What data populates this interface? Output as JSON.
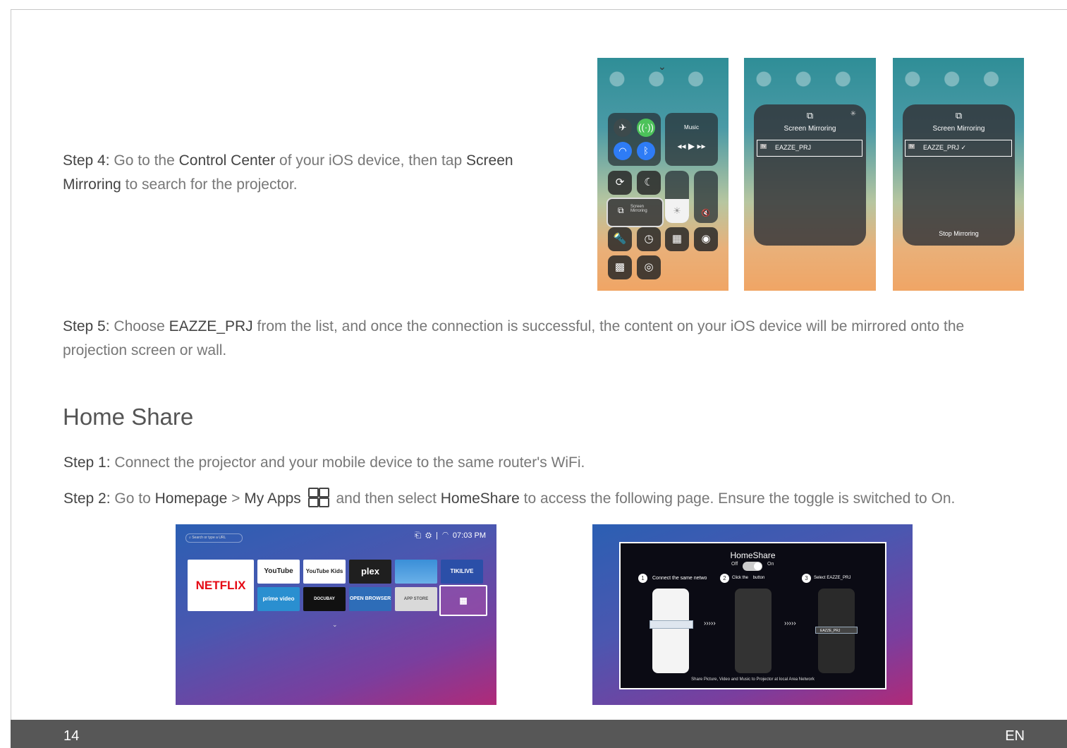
{
  "step4": {
    "label": "Step 4:",
    "t1": " Go to the ",
    "b1": "Control Center",
    "t2": " of your iOS device, then tap ",
    "b2": "Screen",
    "b3": "Mirroring",
    "t3": " to search for the projector."
  },
  "step5": {
    "label": "Step 5:",
    "t1": " Choose ",
    "b1": "EAZZE_PRJ",
    "t2": " from the list, and once the connection is successful, the content on your iOS device will be mirrored onto the",
    "t3": "projection screen or wall."
  },
  "section_title": "Home Share",
  "hs_step1": {
    "label": "Step 1:",
    "text": " Connect the projector and your mobile device to the same router's WiFi."
  },
  "hs_step2": {
    "label": "Step 2:",
    "t1": " Go to ",
    "b1": "Homepage",
    "t2": " > ",
    "b2": "My Apps",
    "t3": " and then select ",
    "b3": "HomeShare",
    "t4": " to access the following page. Ensure the toggle is switched to On."
  },
  "ios": {
    "music": "Music",
    "screen_mirroring_small": "Screen\nMirroring",
    "screen_mirroring": "Screen Mirroring",
    "device": "EAZZE_PRJ",
    "device_connected": "EAZZE_PRJ ✓",
    "stop": "Stop Mirroring"
  },
  "tv1": {
    "search_placeholder": "Search or type a URL",
    "time": "07:03 PM",
    "apps": [
      "NETFLIX",
      "YouTube",
      "YouTube Kids",
      "plex",
      "TIKILIVE",
      "prime video",
      "DOCUBAY",
      "OPEN BROWSER",
      "APP STORE"
    ]
  },
  "tv2": {
    "title": "HomeShare",
    "off": "Off",
    "on": "On",
    "s1": "Connect the same netwo",
    "s2": "Click the    button",
    "s3": "Select EAZZE_PRJ",
    "n1": "1",
    "n2": "2",
    "n3": "3",
    "arrows": "›››››",
    "device": "EAZZE_PRJ",
    "footer": "Share Picture, Video and Music to Projector at local Area Network"
  },
  "footer": {
    "page": "14",
    "lang": "EN"
  }
}
